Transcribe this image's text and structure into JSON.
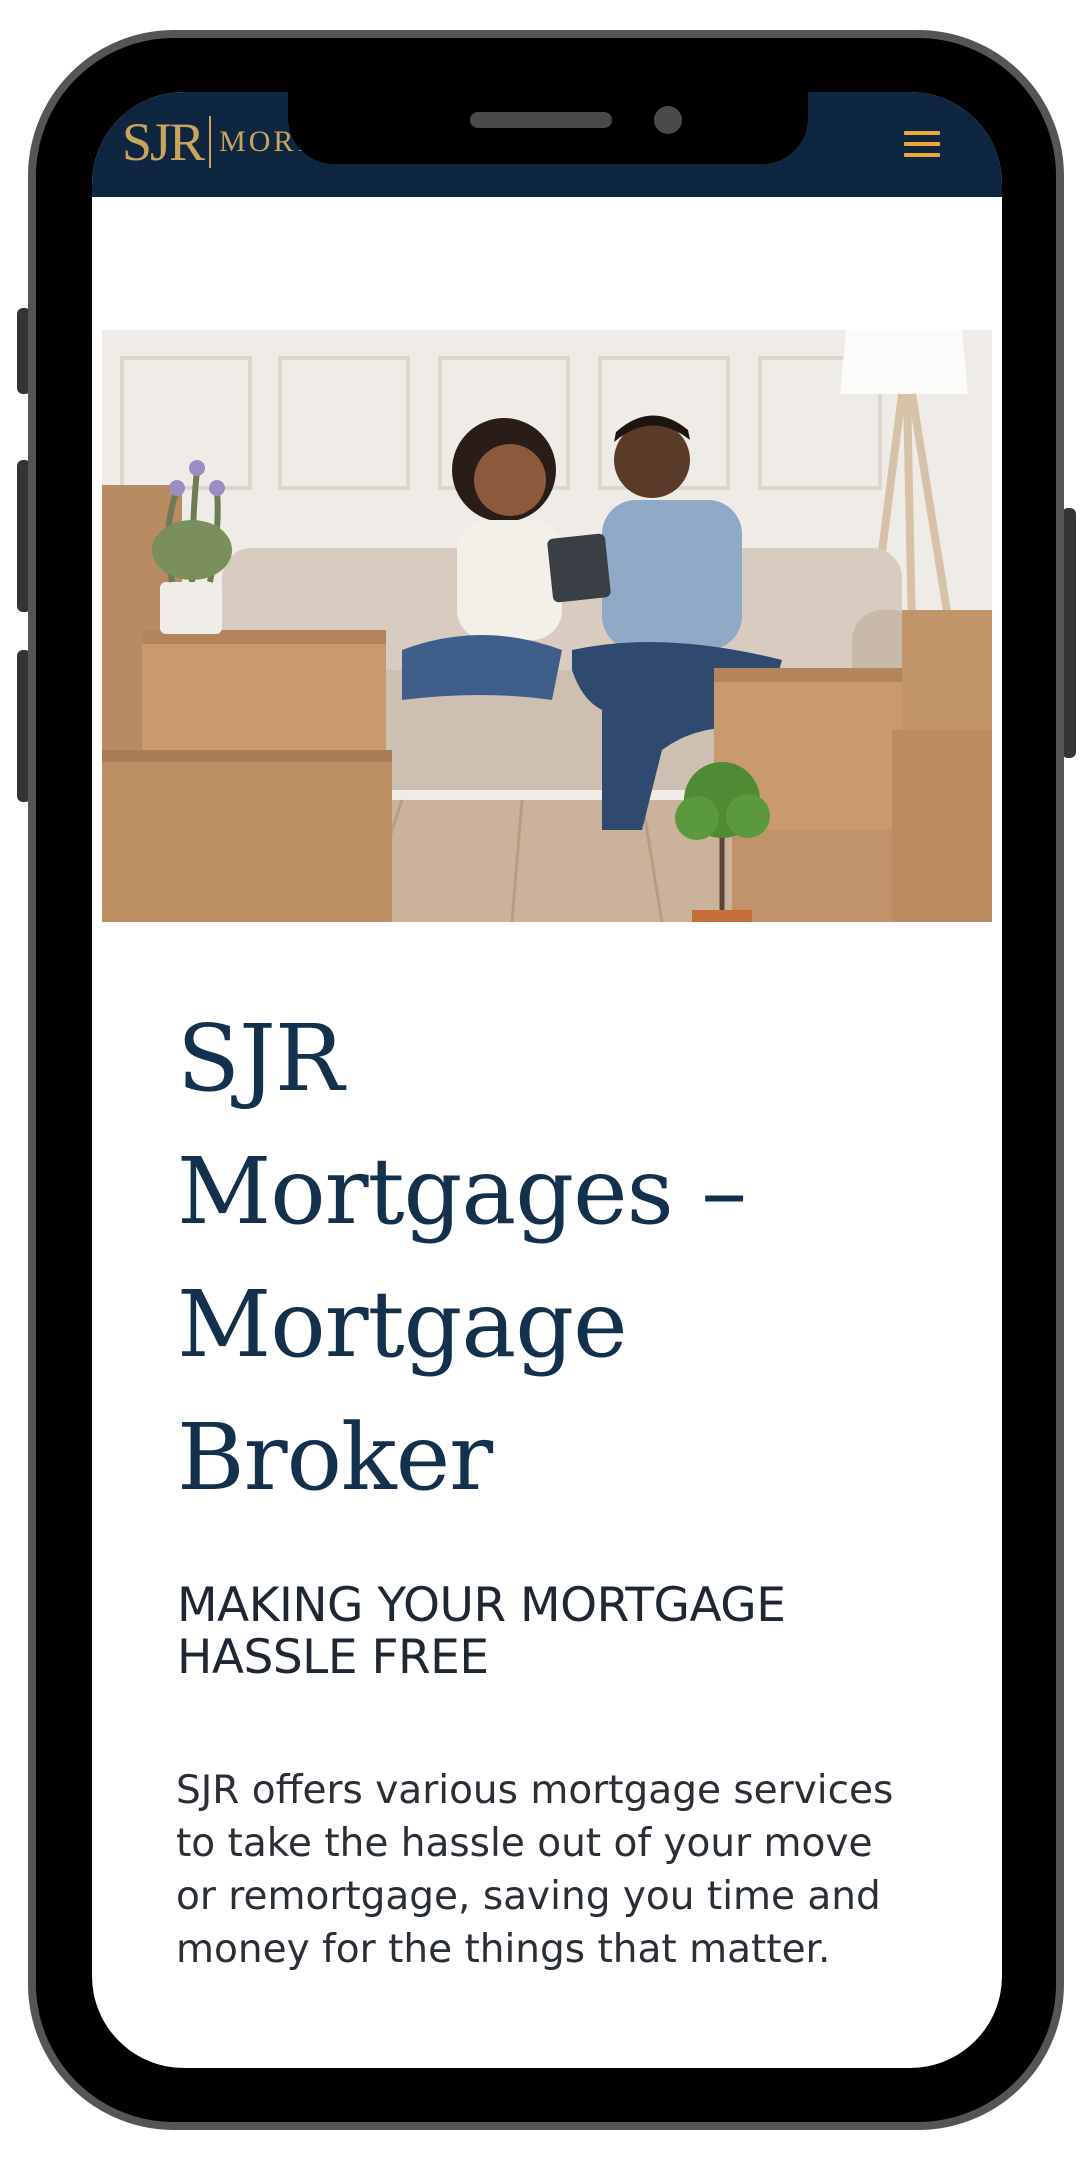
{
  "colors": {
    "header_bg": "#0f2640",
    "brand_gold": "#c9a45c",
    "heading": "#13304d",
    "body_text": "#2a2f36"
  },
  "header": {
    "logo_mark": "SJR",
    "logo_word": "MORT",
    "menu_icon": "hamburger-menu-icon"
  },
  "hero": {
    "description_icon": "photo-couple-with-moving-boxes"
  },
  "content": {
    "title": "SJR Mortgages – Mortgage Broker",
    "title_lines": [
      "SJR",
      "Mortgages –",
      "Mortgage",
      "Broker"
    ],
    "subtitle_lines": [
      "MAKING YOUR MORTGAGE",
      "HASSLE FREE"
    ],
    "paragraph": "SJR offers various mortgage services to take the hassle out of your move or remortgage, saving you time and money for the things that matter."
  }
}
